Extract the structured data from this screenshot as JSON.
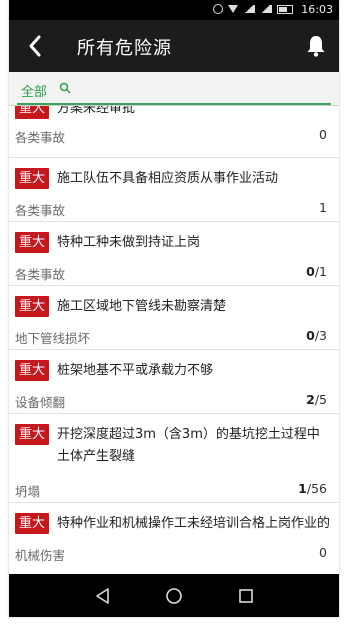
{
  "status_bar": {
    "time": "16:03"
  },
  "header": {
    "title": "所有危险源"
  },
  "filter": {
    "label": "全部"
  },
  "list": [
    {
      "badge": "重大",
      "title": "方案未经审批",
      "category": "各类事故",
      "count_strong": "",
      "count": "0"
    },
    {
      "badge": "重大",
      "title": "施工队伍不具备相应资质从事作业活动",
      "category": "各类事故",
      "count_strong": "",
      "count": "1"
    },
    {
      "badge": "重大",
      "title": "特种工种未做到持证上岗",
      "category": "各类事故",
      "count_strong": "0",
      "count": "/1"
    },
    {
      "badge": "重大",
      "title": "施工区域地下管线未勘察清楚",
      "category": "地下管线损坏",
      "count_strong": "0",
      "count": "/3"
    },
    {
      "badge": "重大",
      "title": "桩架地基不平或承载力不够",
      "category": "设备倾翻",
      "count_strong": "2",
      "count": "/5"
    },
    {
      "badge": "重大",
      "title": "开挖深度超过3m（含3m）的基坑挖土过程中土体产生裂缝",
      "category": "坍塌",
      "count_strong": "1",
      "count": "/56"
    },
    {
      "badge": "重大",
      "title": "特种作业和机械操作工未经培训合格上岗作业的",
      "category": "机械伤害",
      "count_strong": "",
      "count": "0"
    }
  ],
  "icons": {
    "back": "back-arrow-icon",
    "bell": "bell-icon",
    "search": "search-icon",
    "nav_back": "triangle-back-icon",
    "nav_home": "circle-home-icon",
    "nav_recents": "square-recents-icon"
  },
  "colors": {
    "header": "#1c1c1c",
    "badge": "#c8161d",
    "accent": "#2e9e4a"
  }
}
